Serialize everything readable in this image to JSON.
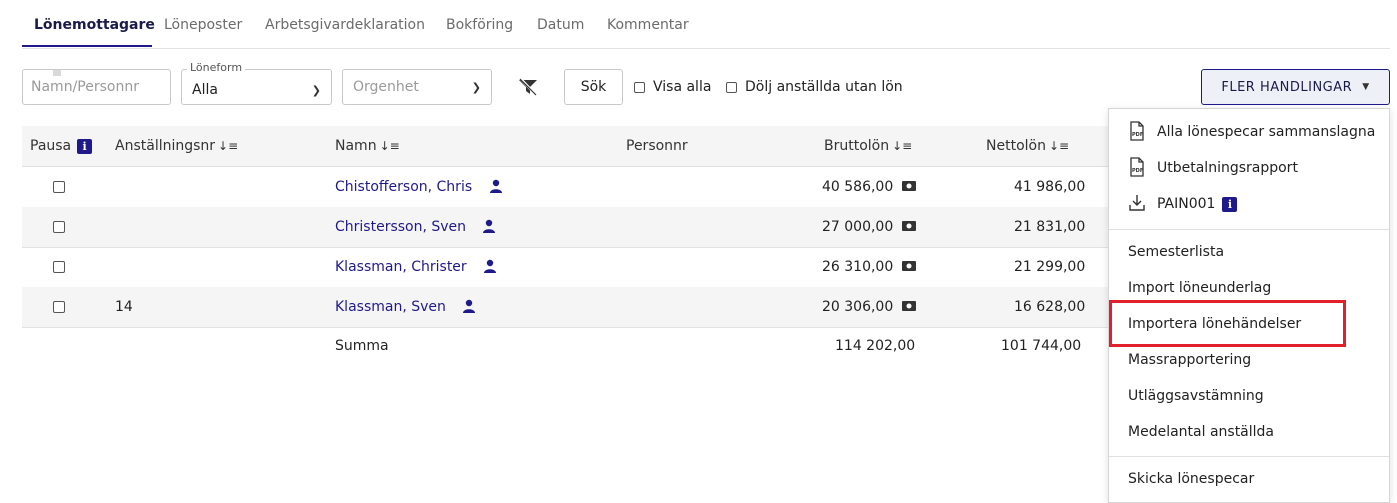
{
  "tabs": [
    {
      "label": "Lönemottagare",
      "active": true
    },
    {
      "label": "Löneposter",
      "active": false
    },
    {
      "label": "Arbetsgivardeklaration",
      "active": false
    },
    {
      "label": "Bokföring",
      "active": false
    },
    {
      "label": "Datum",
      "active": false
    },
    {
      "label": "Kommentar",
      "active": false
    }
  ],
  "filters": {
    "name_placeholder": "Namn/Personnr",
    "loneform_label": "Löneform",
    "loneform_value": "Alla",
    "orgenhet_placeholder": "Orgenhet",
    "search_label": "Sök",
    "visa_alla_label": "Visa alla",
    "dolj_label": "Dölj anställda utan lön",
    "more_actions_label": "FLER HANDLINGAR"
  },
  "table": {
    "headers": {
      "pausa": "Pausa",
      "anstnr": "Anställningsnr",
      "namn": "Namn",
      "personnr": "Personnr",
      "brutto": "Bruttolön",
      "netto": "Nettolön"
    },
    "rows": [
      {
        "anstnr": "",
        "namn": "Chistofferson, Chris",
        "personnr": "",
        "brutto": "40 586,00",
        "netto": "41 986,00"
      },
      {
        "anstnr": "",
        "namn": "Christersson, Sven",
        "personnr": "",
        "brutto": "27 000,00",
        "netto": "21 831,00"
      },
      {
        "anstnr": "",
        "namn": "Klassman, Christer",
        "personnr": "",
        "brutto": "26 310,00",
        "netto": "21 299,00"
      },
      {
        "anstnr": "14",
        "namn": "Klassman, Sven",
        "personnr": "",
        "brutto": "20 306,00",
        "netto": "16 628,00"
      }
    ],
    "summary": {
      "label": "Summa",
      "brutto": "114 202,00",
      "netto": "101 744,00"
    }
  },
  "menu": {
    "items": [
      {
        "label": "Alla lönespecar sammanslagna",
        "icon": "pdf-icon"
      },
      {
        "label": "Utbetalningsrapport",
        "icon": "pdf-icon"
      },
      {
        "label": "PAIN001",
        "icon": "download-icon"
      },
      {
        "label": "Semesterlista"
      },
      {
        "label": "Import löneunderlag"
      },
      {
        "label": "Importera lönehändelser",
        "highlighted": true
      },
      {
        "label": "Massrapportering"
      },
      {
        "label": "Utläggsavstämning"
      },
      {
        "label": "Medelantal anställda"
      },
      {
        "label": "Skicka lönespecar"
      }
    ]
  },
  "colors": {
    "accent": "#1f1a8a",
    "highlight_border": "#e0202a"
  }
}
